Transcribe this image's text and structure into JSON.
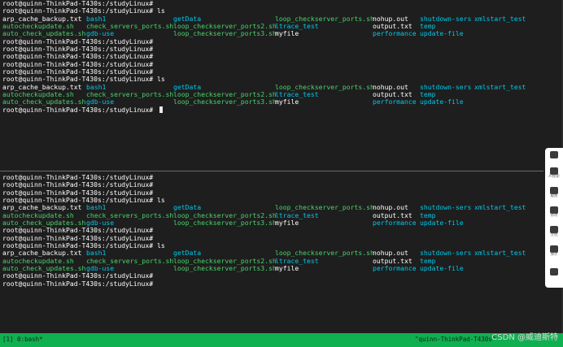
{
  "panes": [
    {
      "name": "top",
      "lines": [
        {
          "type": "prompt",
          "text": "root@quinn-ThinkPad-T430s:/studyLinux# "
        },
        {
          "type": "prompt",
          "text": "root@quinn-ThinkPad-T430s:/studyLinux# ls"
        },
        {
          "type": "files",
          "row": 0
        },
        {
          "type": "files",
          "row": 1
        },
        {
          "type": "files",
          "row": 2
        },
        {
          "type": "prompt",
          "text": "root@quinn-ThinkPad-T430s:/studyLinux# "
        },
        {
          "type": "prompt",
          "text": "root@quinn-ThinkPad-T430s:/studyLinux# "
        },
        {
          "type": "prompt",
          "text": "root@quinn-ThinkPad-T430s:/studyLinux# "
        },
        {
          "type": "prompt",
          "text": "root@quinn-ThinkPad-T430s:/studyLinux# "
        },
        {
          "type": "prompt",
          "text": "root@quinn-ThinkPad-T430s:/studyLinux# "
        },
        {
          "type": "prompt",
          "text": "root@quinn-ThinkPad-T430s:/studyLinux# ls"
        },
        {
          "type": "files",
          "row": 0
        },
        {
          "type": "files",
          "row": 1
        },
        {
          "type": "files",
          "row": 2
        },
        {
          "type": "prompt",
          "text": "root@quinn-ThinkPad-T430s:/studyLinux# ",
          "cursor": true
        }
      ]
    },
    {
      "name": "bottom",
      "lines": [
        {
          "type": "prompt",
          "text": "root@quinn-ThinkPad-T430s:/studyLinux# "
        },
        {
          "type": "prompt",
          "text": "root@quinn-ThinkPad-T430s:/studyLinux# "
        },
        {
          "type": "prompt",
          "text": "root@quinn-ThinkPad-T430s:/studyLinux# "
        },
        {
          "type": "prompt",
          "text": "root@quinn-ThinkPad-T430s:/studyLinux# ls"
        },
        {
          "type": "files",
          "row": 0
        },
        {
          "type": "files",
          "row": 1
        },
        {
          "type": "files",
          "row": 2
        },
        {
          "type": "prompt",
          "text": "root@quinn-ThinkPad-T430s:/studyLinux# "
        },
        {
          "type": "prompt",
          "text": "root@quinn-ThinkPad-T430s:/studyLinux# "
        },
        {
          "type": "prompt",
          "text": "root@quinn-ThinkPad-T430s:/studyLinux# ls"
        },
        {
          "type": "files",
          "row": 0
        },
        {
          "type": "files",
          "row": 1
        },
        {
          "type": "files",
          "row": 2
        },
        {
          "type": "prompt",
          "text": "root@quinn-ThinkPad-T430s:/studyLinux# "
        },
        {
          "type": "prompt",
          "text": "root@quinn-ThinkPad-T430s:/studyLinux# "
        }
      ]
    }
  ],
  "ls_output": [
    [
      {
        "name": "arp_cache_backup.txt",
        "color": "white"
      },
      {
        "name": "bash1",
        "color": "cyan"
      },
      {
        "name": "getData",
        "color": "cyan"
      },
      {
        "name": "loop_checkserver_ports.sh",
        "color": "green"
      },
      {
        "name": "nohup.out",
        "color": "white"
      },
      {
        "name": "shutdown-sers",
        "color": "cyan"
      },
      {
        "name": "xmlstart_test",
        "color": "cyan"
      }
    ],
    [
      {
        "name": "autocheckupdate.sh",
        "color": "green"
      },
      {
        "name": "check_servers_ports.sh",
        "color": "green"
      },
      {
        "name": "loop_checkserver_ports2.sh",
        "color": "green"
      },
      {
        "name": "ltrace_test",
        "color": "cyan"
      },
      {
        "name": "output.txt",
        "color": "white"
      },
      {
        "name": "temp",
        "color": "cyan"
      }
    ],
    [
      {
        "name": "auto_check_updates.sh",
        "color": "green"
      },
      {
        "name": "gdb-use",
        "color": "cyan"
      },
      {
        "name": "loop_checkserver_ports3.sh",
        "color": "green"
      },
      {
        "name": "myfile",
        "color": "white"
      },
      {
        "name": "performance",
        "color": "cyan"
      },
      {
        "name": "update-file",
        "color": "cyan"
      }
    ]
  ],
  "status_bar": {
    "left": "[1] 0:bash*",
    "right": "\"quinn-ThinkPad-T430s\""
  },
  "watermark": "CSDN @威迪斯特",
  "side_toolbar": [
    {
      "icon": "shield-icon",
      "label": ""
    },
    {
      "icon": "ai-search-icon",
      "label": "AI搜索"
    },
    {
      "icon": "translate-icon",
      "label": "截图"
    },
    {
      "icon": "doc-icon",
      "label": "修改"
    },
    {
      "icon": "text-icon",
      "label": "文档"
    },
    {
      "icon": "save-icon",
      "label": "保存"
    },
    {
      "icon": "chevron-icon",
      "label": ""
    }
  ],
  "colors": {
    "background": "#1e1e1e",
    "prompt": "#ffffff",
    "directory": "#00c8e8",
    "executable": "#4ad36c",
    "status_bar": "#10b050"
  }
}
